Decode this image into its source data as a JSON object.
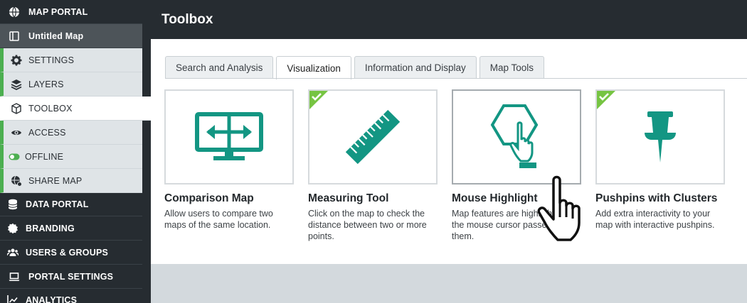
{
  "sidebar": {
    "items": [
      {
        "label": "MAP PORTAL",
        "icon": "globe-icon"
      },
      {
        "label": "Untitled Map",
        "icon": "map-book-icon"
      },
      {
        "label": "SETTINGS",
        "icon": "gear-icon"
      },
      {
        "label": "LAYERS",
        "icon": "layers-icon"
      },
      {
        "label": "TOOLBOX",
        "icon": "cube-icon"
      },
      {
        "label": "ACCESS",
        "icon": "eye-icon"
      },
      {
        "label": "OFFLINE",
        "icon": "toggle-icon"
      },
      {
        "label": "SHARE MAP",
        "icon": "share-globe-icon"
      },
      {
        "label": "DATA PORTAL",
        "icon": "database-icon"
      },
      {
        "label": "BRANDING",
        "icon": "badge-icon"
      },
      {
        "label": "USERS & GROUPS",
        "icon": "users-icon"
      },
      {
        "label": "PORTAL SETTINGS",
        "icon": "laptop-icon"
      },
      {
        "label": "ANALYTICS",
        "icon": "chart-icon"
      }
    ]
  },
  "header": {
    "title": "Toolbox"
  },
  "tabs": [
    {
      "label": "Search and Analysis"
    },
    {
      "label": "Visualization"
    },
    {
      "label": "Information and Display"
    },
    {
      "label": "Map Tools"
    }
  ],
  "cards": [
    {
      "title": "Comparison Map",
      "desc": "Allow users to compare two maps of the same location.",
      "icon": "monitor-compare-icon"
    },
    {
      "title": "Measuring Tool",
      "desc": "Click on the map to check the distance between two or more points.",
      "icon": "ruler-icon"
    },
    {
      "title": "Mouse Highlight",
      "desc": "Map features are highlighted as the mouse cursor passes over them.",
      "icon": "hexagon-pointer-icon"
    },
    {
      "title": "Pushpins with Clusters",
      "desc": "Add extra interactivity to your map with interactive pushpins.",
      "icon": "pushpin-icon"
    }
  ],
  "colors": {
    "accent": "#139683",
    "sidebar": "#262c31",
    "enabled_check": "#76c442",
    "sidebar_marker": "#4caf50"
  }
}
